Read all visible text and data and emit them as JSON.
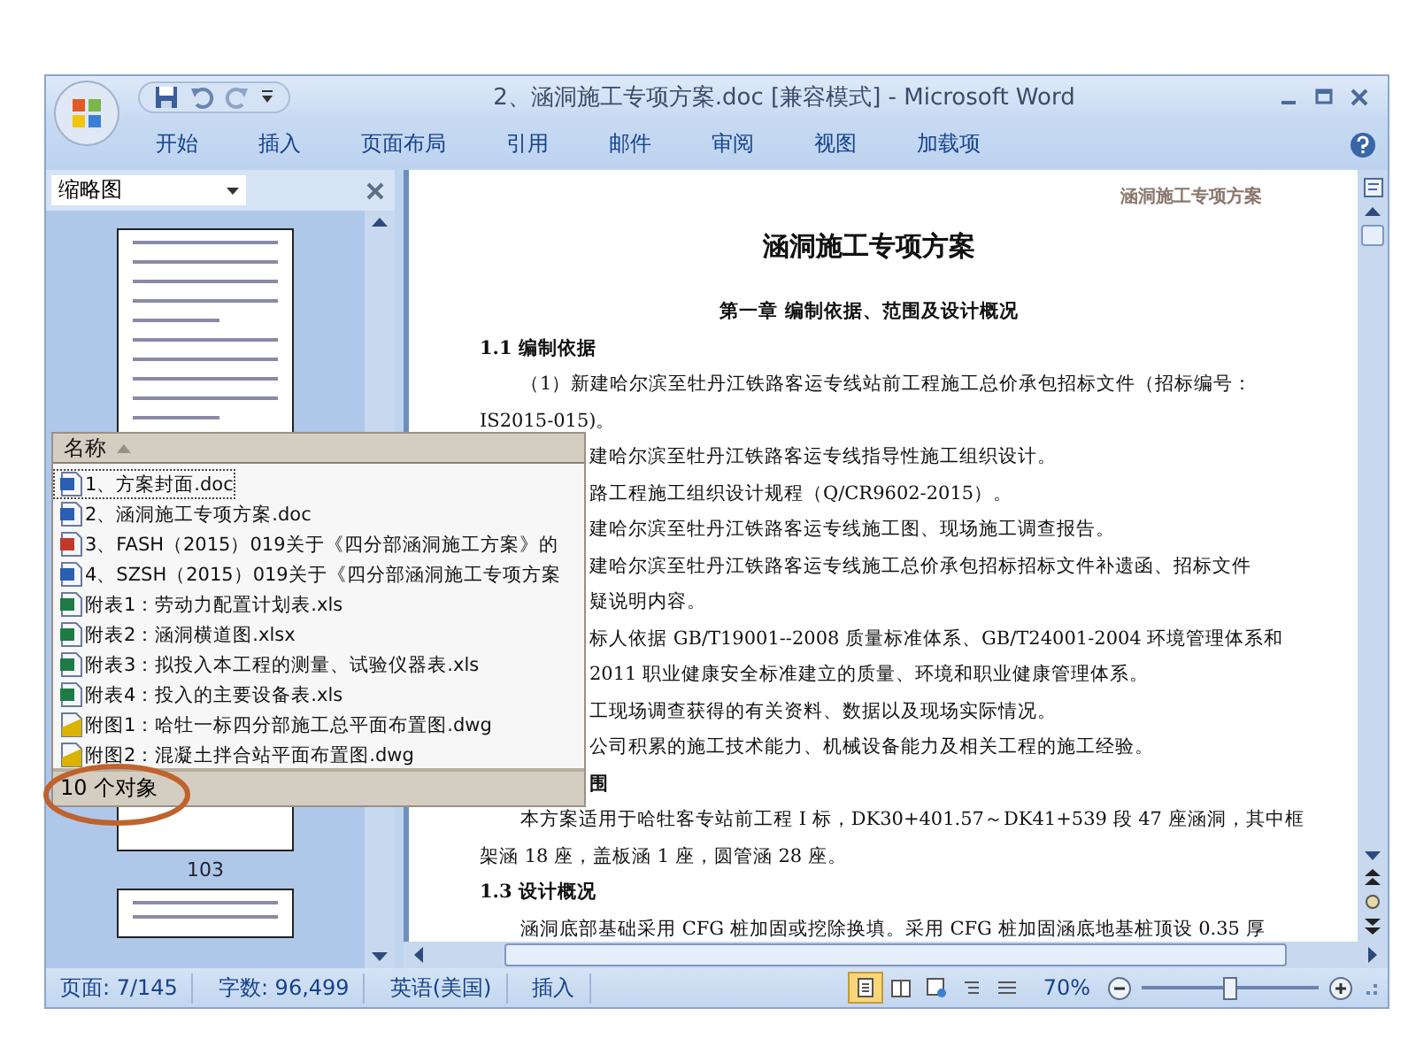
{
  "window": {
    "title": "2、涵洞施工专项方案.doc [兼容模式] - Microsoft Word"
  },
  "ribbon_tabs": [
    "开始",
    "插入",
    "页面布局",
    "引用",
    "邮件",
    "审阅",
    "视图",
    "加载项"
  ],
  "thumbnail_pane": {
    "title": "缩略图",
    "page_label": "103"
  },
  "document": {
    "header": "涵洞施工专项方案",
    "lines": [
      {
        "kind": "title",
        "text": "涵洞施工专项方案"
      },
      {
        "kind": "chapter",
        "text": "第一章  编制依据、范围及设计概况"
      },
      {
        "kind": "heading",
        "text": "1.1 编制依据"
      },
      {
        "kind": "para",
        "text": "（1）新建哈尔滨至牡丹江铁路客运专线站前工程施工总价承包招标文件（招标编号："
      },
      {
        "kind": "cont",
        "text": "IS2015-015)。"
      },
      {
        "kind": "clipped",
        "text": "建哈尔滨至牡丹江铁路客运专线指导性施工组织设计。"
      },
      {
        "kind": "clipped",
        "text": "路工程施工组织设计规程（Q/CR9602-2015）。"
      },
      {
        "kind": "clipped",
        "text": "建哈尔滨至牡丹江铁路客运专线施工图、现场施工调查报告。"
      },
      {
        "kind": "clipped",
        "text": "建哈尔滨至牡丹江铁路客运专线施工总价承包招标招标文件补遗函、招标文件"
      },
      {
        "kind": "clipped",
        "text": "疑说明内容。"
      },
      {
        "kind": "clipped",
        "text": "标人依据 GB/T19001--2008 质量标准体系、GB/T24001-2004 环境管理体系和"
      },
      {
        "kind": "clipped",
        "text": "2011 职业健康安全标准建立的质量、环境和职业健康管理体系。"
      },
      {
        "kind": "clipped",
        "text": "工现场调查获得的有关资料、数据以及现场实际情况。"
      },
      {
        "kind": "clipped",
        "text": "公司积累的施工技术能力、机械设备能力及相关工程的施工经验。"
      },
      {
        "kind": "clipped-heading",
        "text": "围"
      },
      {
        "kind": "para",
        "text": "本方案适用于哈牡客专站前工程 I 标，DK30+401.57～DK41+539 段 47 座涵洞，其中框"
      },
      {
        "kind": "cont",
        "text": "架涵 18 座，盖板涵 1 座，圆管涵 28 座。"
      },
      {
        "kind": "heading",
        "text": "1.3 设计概况"
      },
      {
        "kind": "para",
        "text": "涵洞底部基础采用 CFG 桩加固或挖除换填。采用 CFG 桩加固涵底地基桩顶设 0.35 厚"
      }
    ]
  },
  "file_popup": {
    "column": "名称",
    "files": [
      {
        "name": "1、方案封面.doc",
        "kind": "word",
        "selected": true
      },
      {
        "name": "2、涵洞施工专项方案.doc",
        "kind": "word",
        "selected": false
      },
      {
        "name": "3、FASH（2015）019关于《四分部涵洞施工方案》的",
        "kind": "pdf",
        "selected": false
      },
      {
        "name": "4、SZSH（2015）019关于《四分部涵洞施工专项方案",
        "kind": "word",
        "selected": false
      },
      {
        "name": "附表1：劳动力配置计划表.xls",
        "kind": "excel",
        "selected": false
      },
      {
        "name": "附表2：涵洞横道图.xlsx",
        "kind": "excel",
        "selected": false
      },
      {
        "name": "附表3：拟投入本工程的测量、试验仪器表.xls",
        "kind": "excel",
        "selected": false
      },
      {
        "name": "附表4：投入的主要设备表.xls",
        "kind": "excel",
        "selected": false
      },
      {
        "name": "附图1：哈牡一标四分部施工总平面布置图.dwg",
        "kind": "cad",
        "selected": false
      },
      {
        "name": "附图2：混凝土拌合站平面布置图.dwg",
        "kind": "cad",
        "selected": false
      }
    ],
    "status": "10 个对象"
  },
  "status_bar": {
    "page": "页面: 7/145",
    "words": "字数: 96,499",
    "language": "英语(美国)",
    "mode": "插入",
    "views": [
      {
        "kind": "print",
        "selected": true
      },
      {
        "kind": "reading",
        "selected": false
      },
      {
        "kind": "web",
        "selected": false
      },
      {
        "kind": "outline",
        "selected": false
      },
      {
        "kind": "draft",
        "selected": false
      }
    ],
    "zoom": "70%",
    "zoom_slider": {
      "level": 0.5
    }
  }
}
